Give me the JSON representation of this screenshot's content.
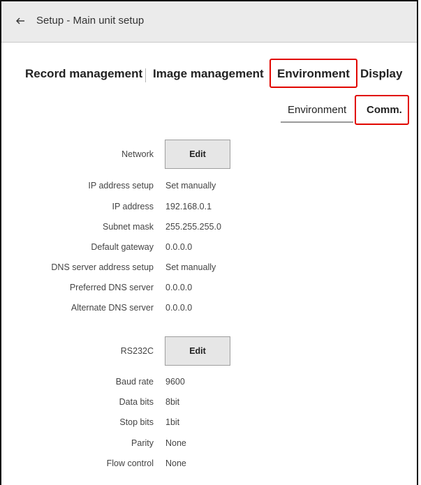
{
  "header": {
    "back_icon": "arrow-left-icon",
    "title": "Setup - Main unit setup"
  },
  "main_tabs": [
    {
      "label": "Record management"
    },
    {
      "label": "Image management"
    },
    {
      "label": "Environment",
      "highlighted": true
    },
    {
      "label": "Display"
    }
  ],
  "sub_tabs": [
    {
      "label": "Environment",
      "selected": true
    },
    {
      "label": "Comm.",
      "highlighted": true
    }
  ],
  "highlight_color": "#e10600",
  "network": {
    "label": "Network",
    "edit_label": "Edit",
    "rows": [
      {
        "label": "IP address setup",
        "value": "Set manually"
      },
      {
        "label": "IP address",
        "value": "192.168.0.1"
      },
      {
        "label": "Subnet mask",
        "value": "255.255.255.0"
      },
      {
        "label": "Default gateway",
        "value": "0.0.0.0"
      },
      {
        "label": "DNS server address setup",
        "value": "Set manually"
      },
      {
        "label": "Preferred DNS server",
        "value": "0.0.0.0"
      },
      {
        "label": "Alternate DNS server",
        "value": "0.0.0.0"
      }
    ]
  },
  "rs232c": {
    "label": "RS232C",
    "edit_label": "Edit",
    "rows": [
      {
        "label": "Baud rate",
        "value": "9600"
      },
      {
        "label": "Data bits",
        "value": "8bit"
      },
      {
        "label": "Stop bits",
        "value": "1bit"
      },
      {
        "label": "Parity",
        "value": "None"
      },
      {
        "label": "Flow control",
        "value": "None"
      }
    ]
  }
}
